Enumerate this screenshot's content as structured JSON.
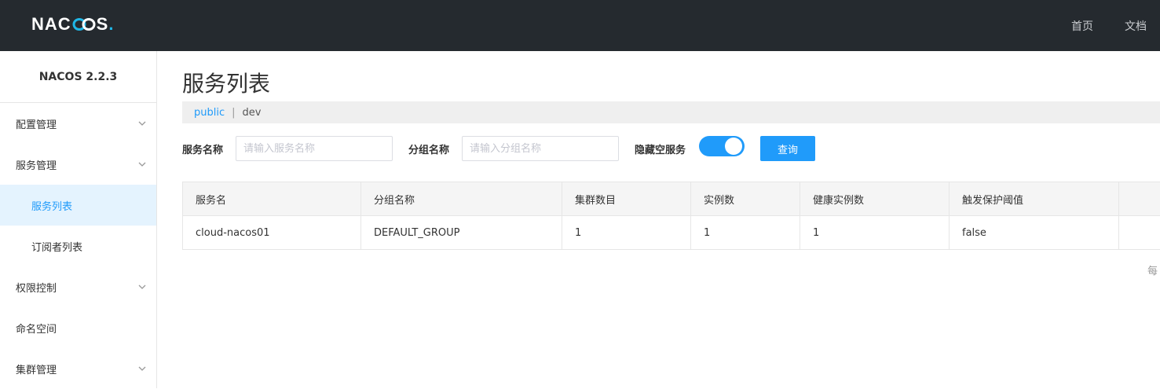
{
  "header": {
    "logo_text": "NACOS.",
    "nav": {
      "home": "首页",
      "docs": "文档"
    }
  },
  "sidebar": {
    "version": "NACOS 2.2.3",
    "items": [
      {
        "label": "配置管理",
        "expandable": true
      },
      {
        "label": "服务管理",
        "expandable": true
      },
      {
        "label": "服务列表",
        "sub": true,
        "active": true
      },
      {
        "label": "订阅者列表",
        "sub": true
      },
      {
        "label": "权限控制",
        "expandable": true
      },
      {
        "label": "命名空间",
        "expandable": false
      },
      {
        "label": "集群管理",
        "expandable": true
      }
    ]
  },
  "main": {
    "title": "服务列表",
    "namespaces": {
      "active": "public",
      "separator": "|",
      "other": "dev"
    },
    "filter": {
      "service_label": "服务名称",
      "service_placeholder": "请输入服务名称",
      "group_label": "分组名称",
      "group_placeholder": "请输入分组名称",
      "hide_empty_label": "隐藏空服务",
      "hide_empty_on": true,
      "query_button": "查询"
    },
    "table": {
      "columns": [
        "服务名",
        "分组名称",
        "集群数目",
        "实例数",
        "健康实例数",
        "触发保护阈值",
        ""
      ],
      "rows": [
        [
          "cloud-nacos01",
          "DEFAULT_GROUP",
          "1",
          "1",
          "1",
          "false",
          ""
        ]
      ]
    },
    "pagination_text": "每"
  },
  "colors": {
    "accent": "#209bfa",
    "topbar": "#252a2f",
    "logo_dot": "#1fb6e6"
  }
}
